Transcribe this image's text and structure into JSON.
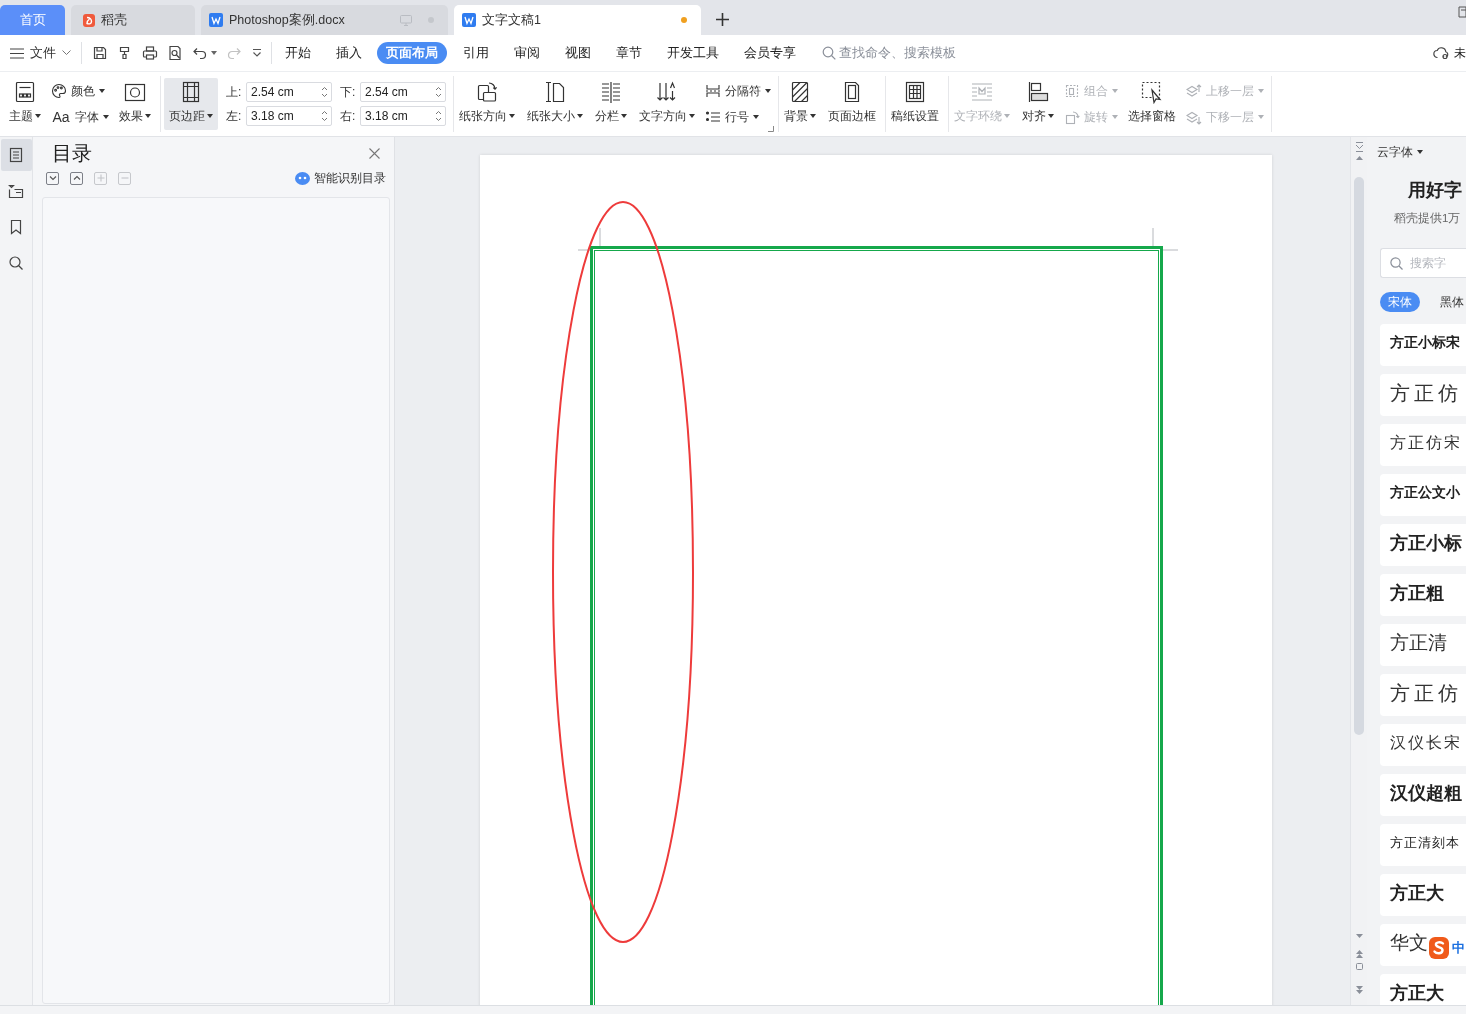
{
  "tabs": [
    {
      "kind": "home",
      "label": "首页",
      "selected": false
    },
    {
      "kind": "app",
      "label": "稻壳",
      "selected": false
    },
    {
      "kind": "doc",
      "label": "Photoshop案例.docx",
      "selected": false,
      "unsaved": false
    },
    {
      "kind": "doc",
      "label": "文字文稿1",
      "selected": true,
      "unsaved": true
    }
  ],
  "menu": {
    "file": "文件",
    "quick_tools": [
      {
        "disabled": false
      },
      {
        "disabled": false
      },
      {
        "disabled": false
      },
      {
        "disabled": false
      },
      {
        "disabled": false,
        "dropdown": true
      },
      {
        "disabled": true
      }
    ],
    "tabs": [
      {
        "label": "开始",
        "selected": false
      },
      {
        "label": "插入",
        "selected": false
      },
      {
        "label": "页面布局",
        "selected": true
      },
      {
        "label": "引用",
        "selected": false
      },
      {
        "label": "审阅",
        "selected": false
      },
      {
        "label": "视图",
        "selected": false
      },
      {
        "label": "章节",
        "selected": false
      },
      {
        "label": "开发工具",
        "selected": false
      },
      {
        "label": "会员专享",
        "selected": false
      }
    ],
    "search": {
      "placeholder": "查找命令、搜索模板"
    },
    "sync_status": "未"
  },
  "ribbon": {
    "groups": [
      {
        "columns": [
          {
            "kind": "large",
            "items": [
              {
                "label": "主题",
                "dropdown": true,
                "disabled": false,
                "highlighted": false
              }
            ]
          },
          {
            "kind": "stack",
            "items": [
              {
                "label": "颜色",
                "dropdown": true,
                "disabled": false,
                "highlighted": false
              },
              {
                "glyph": "Aa",
                "label": "字体",
                "dropdown": true,
                "disabled": false,
                "highlighted": false
              }
            ]
          },
          {
            "kind": "large",
            "items": [
              {
                "label": "效果",
                "dropdown": true,
                "disabled": false,
                "highlighted": false
              }
            ]
          }
        ]
      },
      {
        "columns": [
          {
            "kind": "large",
            "items": [
              {
                "label": "页边距",
                "dropdown": true,
                "disabled": false,
                "highlighted": true
              }
            ]
          },
          {
            "kind": "fields",
            "items": [
              {
                "label": "上:",
                "value": "2.54 cm"
              },
              {
                "label": "左:",
                "value": "3.18 cm"
              }
            ]
          },
          {
            "kind": "fields",
            "items": [
              {
                "label": "下:",
                "value": "2.54 cm"
              },
              {
                "label": "右:",
                "value": "3.18 cm"
              }
            ]
          }
        ]
      },
      {
        "launcher": true,
        "columns": [
          {
            "kind": "large",
            "items": [
              {
                "label": "纸张方向",
                "dropdown": true,
                "disabled": false,
                "highlighted": false
              }
            ]
          },
          {
            "kind": "large",
            "items": [
              {
                "label": "纸张大小",
                "dropdown": true,
                "disabled": false,
                "highlighted": false
              }
            ]
          },
          {
            "kind": "large",
            "items": [
              {
                "label": "分栏",
                "dropdown": true,
                "disabled": false,
                "highlighted": false
              }
            ]
          },
          {
            "kind": "large",
            "items": [
              {
                "label": "文字方向",
                "dropdown": true,
                "disabled": false,
                "highlighted": false
              }
            ]
          },
          {
            "kind": "stack",
            "items": [
              {
                "label": "分隔符",
                "dropdown": true,
                "disabled": false,
                "highlighted": false
              },
              {
                "label": "行号",
                "dropdown": true,
                "disabled": false,
                "highlighted": false
              }
            ]
          }
        ]
      },
      {
        "columns": [
          {
            "kind": "large",
            "items": [
              {
                "label": "背景",
                "dropdown": true,
                "disabled": false,
                "highlighted": false
              }
            ]
          },
          {
            "kind": "large",
            "items": [
              {
                "label": "页面边框",
                "disabled": false,
                "highlighted": false
              }
            ]
          }
        ]
      },
      {
        "columns": [
          {
            "kind": "large",
            "items": [
              {
                "label": "稿纸设置",
                "disabled": false,
                "highlighted": false
              }
            ]
          }
        ]
      },
      {
        "columns": [
          {
            "kind": "large",
            "items": [
              {
                "label": "文字环绕",
                "dropdown": true,
                "disabled": true,
                "highlighted": false
              }
            ]
          },
          {
            "kind": "large",
            "items": [
              {
                "label": "对齐",
                "dropdown": true,
                "disabled": false,
                "highlighted": false
              }
            ]
          },
          {
            "kind": "stack",
            "items": [
              {
                "label": "组合",
                "dropdown": true,
                "disabled": true,
                "highlighted": false
              },
              {
                "label": "旋转",
                "dropdown": true,
                "disabled": true,
                "highlighted": false
              }
            ]
          },
          {
            "kind": "large",
            "items": [
              {
                "label": "选择窗格",
                "disabled": false,
                "highlighted": false
              }
            ]
          },
          {
            "kind": "stack",
            "items": [
              {
                "label": "上移一层",
                "dropdown": true,
                "disabled": true,
                "highlighted": false
              },
              {
                "label": "下移一层",
                "dropdown": true,
                "disabled": true,
                "highlighted": false
              }
            ]
          }
        ]
      }
    ]
  },
  "left_rail": {
    "items": [
      {
        "selected": true
      },
      {
        "selected": false
      },
      {
        "selected": false
      },
      {
        "selected": false
      }
    ]
  },
  "outline_panel": {
    "title": "目录",
    "tools": [
      {
        "kind": "expand",
        "disabled": false
      },
      {
        "kind": "collapse",
        "disabled": false
      },
      {
        "kind": "add",
        "disabled": true
      },
      {
        "kind": "remove",
        "disabled": true
      }
    ],
    "smart_button": "智能识别目录"
  },
  "font_panel": {
    "title": "云字体",
    "heading": "用好字",
    "subheading": "稻壳提供1万",
    "search": {
      "placeholder": "搜索字"
    },
    "categories": [
      {
        "label": "宋体",
        "selected": true
      },
      {
        "label": "黑体",
        "selected": false
      }
    ],
    "fonts": [
      {
        "name": "方正小标宋",
        "kind": "bold-small"
      },
      {
        "name": "方正仿",
        "kind": "spaced-large"
      },
      {
        "name": "方正仿宋",
        "kind": "spaced"
      },
      {
        "name": "方正公文小",
        "kind": "bold-small"
      },
      {
        "name": "方正小标",
        "kind": "bold"
      },
      {
        "name": "方正粗",
        "kind": "bold"
      },
      {
        "name": "方正清",
        "kind": "regular"
      },
      {
        "name": "方正仿",
        "kind": "spaced-large"
      },
      {
        "name": "汉仪长宋",
        "kind": "spaced"
      },
      {
        "name": "汉仪超粗",
        "kind": "bold"
      },
      {
        "name": "方正清刻本",
        "kind": "small"
      },
      {
        "name": "方正大",
        "kind": "bold"
      },
      {
        "name": "华文",
        "kind": "regular"
      },
      {
        "name": "方正大",
        "kind": "bold"
      }
    ]
  },
  "ime": {
    "label": "中"
  }
}
